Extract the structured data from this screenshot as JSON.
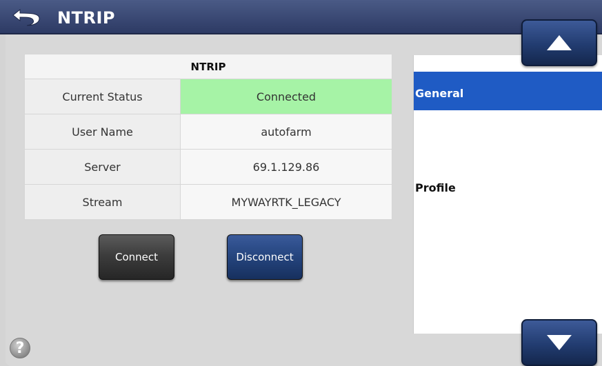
{
  "header": {
    "title": "NTRIP",
    "back_icon": "back-arrow-icon"
  },
  "table": {
    "heading": "NTRIP",
    "rows": [
      {
        "label": "Current Status",
        "value": "Connected",
        "status_color": "#a6f3a6"
      },
      {
        "label": "User Name",
        "value": "autofarm"
      },
      {
        "label": "Server",
        "value": "69.1.129.86"
      },
      {
        "label": "Stream",
        "value": "MYWAYRTK_LEGACY"
      }
    ]
  },
  "buttons": {
    "connect_label": "Connect",
    "disconnect_label": "Disconnect"
  },
  "list": {
    "items": [
      {
        "label": "General",
        "selected": true
      },
      {
        "label": "Profile",
        "selected": false
      }
    ]
  },
  "scroll": {
    "up_icon": "triangle-up-icon",
    "down_icon": "triangle-down-icon"
  },
  "help": {
    "label": "?"
  },
  "colors": {
    "title_bar": "#2d3a64",
    "selected": "#1f5bc4",
    "connected": "#a6f3a6"
  }
}
